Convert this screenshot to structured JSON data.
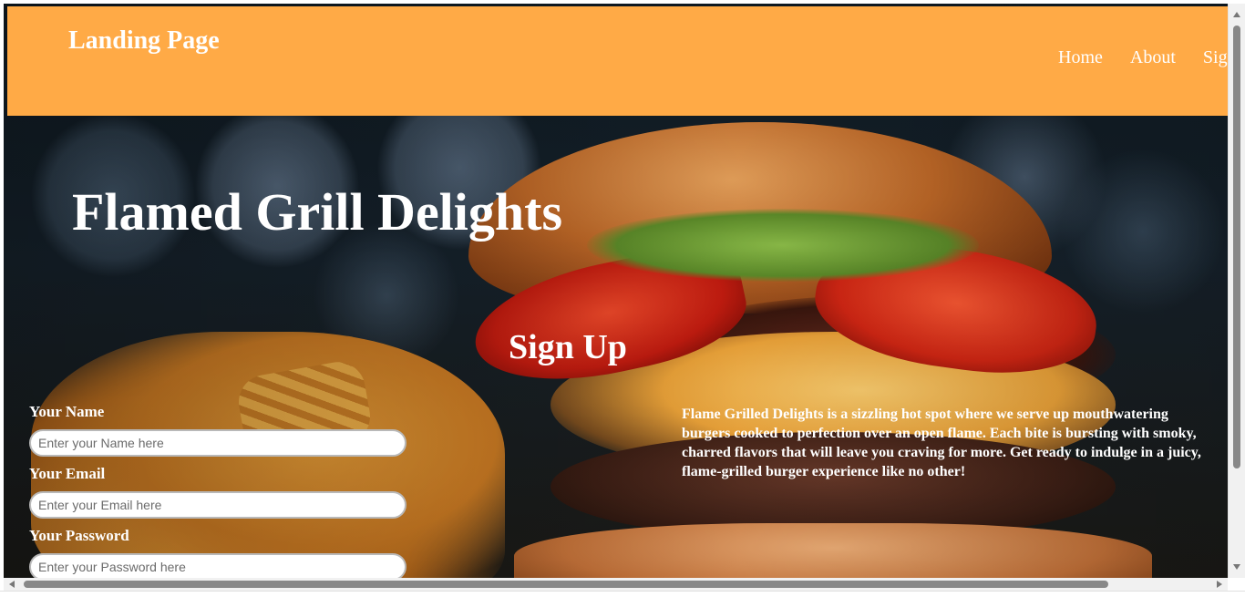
{
  "header": {
    "brand": "Landing Page",
    "nav": [
      "Home",
      "About",
      "Sig"
    ]
  },
  "hero": {
    "title": "Flamed Grill Delights"
  },
  "signup": {
    "title": "Sign Up",
    "fields": [
      {
        "label": "Your Name",
        "placeholder": "Enter your Name here"
      },
      {
        "label": "Your Email",
        "placeholder": "Enter your Email here"
      },
      {
        "label": "Your Password",
        "placeholder": "Enter your Password here"
      }
    ]
  },
  "about": {
    "text": "Flame Grilled Delights is a sizzling hot spot where we serve up mouthwatering burgers cooked to perfection over an open flame. Each bite is bursting with smoky, charred flavors that will leave you craving for more. Get ready to indulge in a juicy, flame-grilled burger experience like no other!"
  },
  "colors": {
    "header_bg": "#ffaa46",
    "text": "#ffffff"
  },
  "icons": [
    "scroll-up-arrow-icon",
    "scroll-down-arrow-icon",
    "scroll-left-arrow-icon",
    "scroll-right-arrow-icon"
  ]
}
